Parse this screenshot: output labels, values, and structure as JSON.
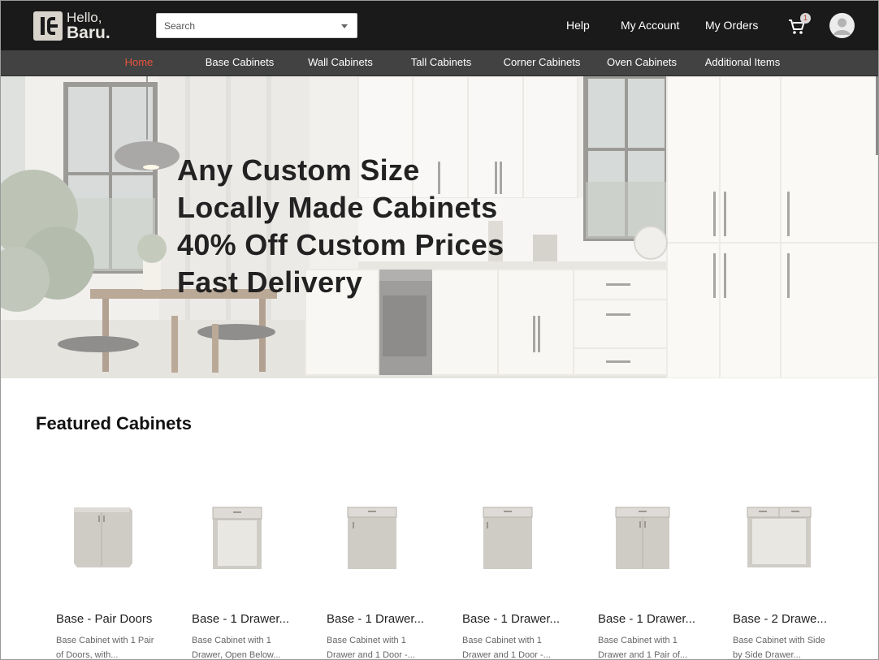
{
  "brand": {
    "hello": "Hello,",
    "name": "Baru."
  },
  "search": {
    "placeholder": "Search"
  },
  "top_links": {
    "help": "Help",
    "account": "My Account",
    "orders": "My Orders"
  },
  "cart": {
    "count": "1",
    "icon": "cart-icon"
  },
  "avatar": {
    "icon": "user-icon"
  },
  "nav": {
    "items": [
      {
        "label": "Home",
        "active": true
      },
      {
        "label": "Base Cabinets"
      },
      {
        "label": "Wall Cabinets"
      },
      {
        "label": "Tall Cabinets"
      },
      {
        "label": "Corner Cabinets"
      },
      {
        "label": "Oven Cabinets"
      },
      {
        "label": "Additional Items"
      }
    ]
  },
  "hero": {
    "lines": [
      "Any Custom Size",
      "Locally Made Cabinets",
      "40% Off Custom Prices",
      "Fast Delivery"
    ]
  },
  "featured": {
    "title": "Featured Cabinets",
    "products": [
      {
        "name": "Base - Pair Doors",
        "desc": "Base Cabinet with 1 Pair of Doors, with..."
      },
      {
        "name": "Base - 1 Drawer...",
        "desc": "Base Cabinet with 1 Drawer, Open Below..."
      },
      {
        "name": "Base - 1 Drawer...",
        "desc": "Base Cabinet with 1 Drawer and 1 Door -..."
      },
      {
        "name": "Base - 1 Drawer...",
        "desc": "Base Cabinet with 1 Drawer and 1 Door -..."
      },
      {
        "name": "Base - 1 Drawer...",
        "desc": "Base Cabinet with 1 Drawer and 1 Pair of..."
      },
      {
        "name": "Base - 2 Drawe...",
        "desc": "Base Cabinet with Side by Side Drawer..."
      }
    ]
  },
  "colors": {
    "topbar": "#1b1a1a",
    "navbar": "#424242",
    "nav_active": "#e8553d",
    "cabinet": "#cfccc6"
  }
}
